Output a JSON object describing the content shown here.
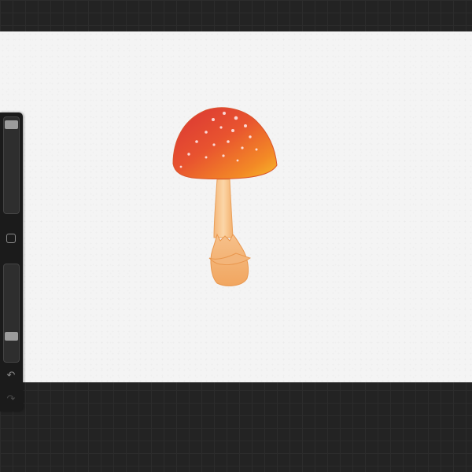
{
  "app": {
    "workspace_background": "#232323",
    "canvas_background": "#f4f4f4"
  },
  "sidebar": {
    "brush_size_slider": {
      "value": 0.0
    },
    "opacity_slider": {
      "value": 0.25
    },
    "modify_button": {
      "icon": "square-outline-icon"
    },
    "undo_button": {
      "icon": "undo-icon",
      "glyph": "↶"
    },
    "redo_button": {
      "icon": "redo-icon",
      "glyph": "↷"
    }
  },
  "artwork": {
    "subject": "mushroom",
    "colors": {
      "cap_red": "#e03a3a",
      "cap_orange": "#f07a2a",
      "cap_yellow": "#f7b92b",
      "stem": "#f7c78f",
      "spots": "#fde6e6"
    }
  }
}
